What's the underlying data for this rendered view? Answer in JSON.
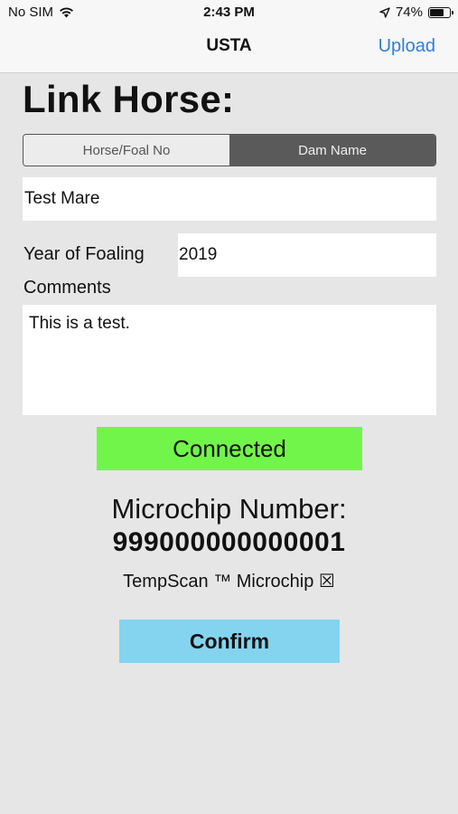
{
  "status_bar": {
    "carrier": "No SIM",
    "time": "2:43 PM",
    "battery": "74%",
    "battery_level": 0.74
  },
  "nav": {
    "title": "USTA",
    "upload_label": "Upload"
  },
  "heading": "Link Horse:",
  "segmented": {
    "options": [
      "Horse/Foal No",
      "Dam Name"
    ],
    "selected": "Dam Name"
  },
  "form": {
    "dam_name_value": "Test Mare",
    "year_label": "Year of Foaling",
    "year_value": "2019",
    "comments_label": "Comments",
    "comments_value": "This is a test."
  },
  "connection": {
    "status": "Connected",
    "color": "#72f54a"
  },
  "microchip": {
    "label": "Microchip Number:",
    "number": "999000000000001",
    "tempscan_label": "TempScan ™ Microchip ☒"
  },
  "confirm_label": "Confirm",
  "colors": {
    "accent": "#2f7de1",
    "confirm_bg": "#84d4ef",
    "segment_selected": "#5a5a5a"
  }
}
